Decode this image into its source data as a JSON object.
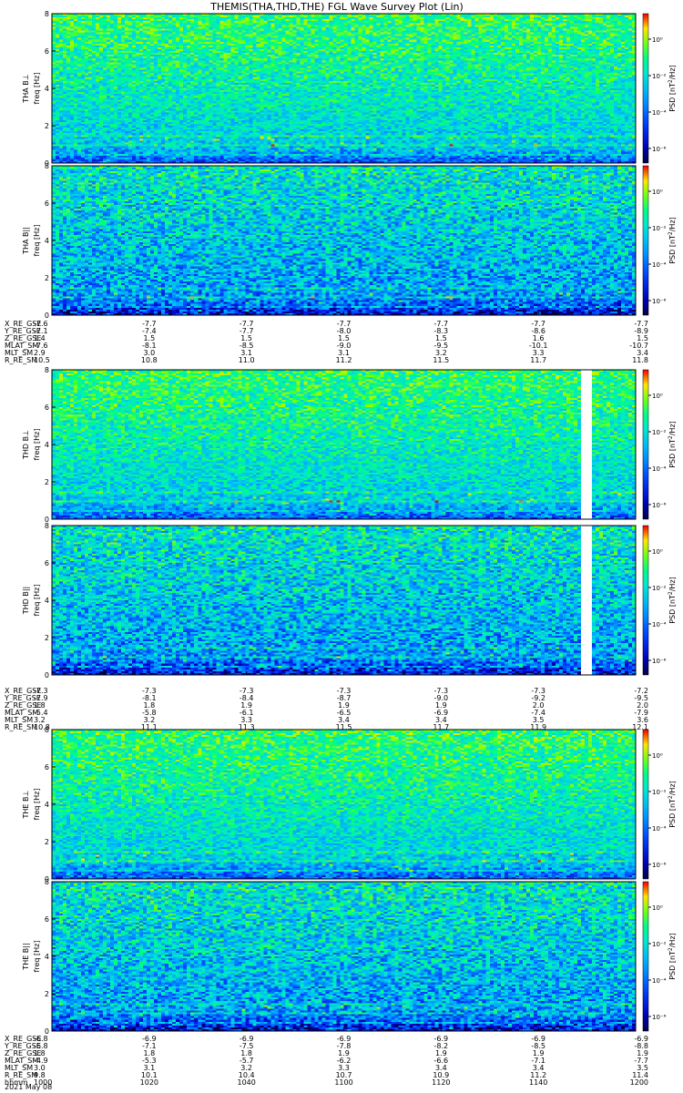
{
  "title": "THEMIS(THA,THD,THE) FGL Wave Survey Plot (Lin)",
  "colorbar_label_prefix": "PSD [nT",
  "colorbar_label_unit": "2",
  "colorbar_label_suffix": "/Hz]",
  "colorbar_ticks": [
    "10⁰",
    "10⁻²",
    "10⁻⁴",
    "10⁻⁶"
  ],
  "colors": {
    "spectrogram_high": "#00ff80",
    "spectrogram_mid": "#00a0ff",
    "spectrogram_low": "#0000c0",
    "spectrogram_min": "#000060",
    "data_gap": "#ffffff"
  },
  "chart_data": {
    "type": "heatmap",
    "x_range_hhmm": [
      "1000",
      "1200"
    ],
    "date": "2021 May 08",
    "ylim": [
      0,
      8
    ],
    "y_ticks": [
      "0",
      "2",
      "4",
      "6",
      "8"
    ],
    "z_scale": "log",
    "z_range": [
      1e-06,
      1.0
    ],
    "panels": [
      {
        "probe": "THA",
        "component": "B⊥",
        "ylabel_probe": "THA B⊥",
        "ylabel_unit": "freq [Hz]",
        "gap": false
      },
      {
        "probe": "THA",
        "component": "B||",
        "ylabel_probe": "THA B||",
        "ylabel_unit": "freq [Hz]",
        "gap": false
      },
      {
        "probe": "THD",
        "component": "B⊥",
        "ylabel_probe": "THD B⊥",
        "ylabel_unit": "freq [Hz]",
        "gap": true,
        "gap_x_fraction": [
          0.912,
          0.925
        ]
      },
      {
        "probe": "THD",
        "component": "B||",
        "ylabel_probe": "THD B||",
        "ylabel_unit": "freq [Hz]",
        "gap": true,
        "gap_x_fraction": [
          0.912,
          0.925
        ]
      },
      {
        "probe": "THE",
        "component": "B⊥",
        "ylabel_probe": "THE B⊥",
        "ylabel_unit": "freq [Hz]",
        "gap": false
      },
      {
        "probe": "THE",
        "component": "B||",
        "ylabel_probe": "THE B||",
        "ylabel_unit": "freq [Hz]",
        "gap": false
      }
    ],
    "ephemeris": [
      {
        "probe": "THA",
        "labels": [
          "X_RE_GSE",
          "Y_RE_GSE",
          "Z_RE_GSE",
          "MLAT_SM",
          "MLT_SM",
          "R_RE_SM"
        ],
        "rows": [
          [
            "-7.6",
            "-7.7",
            "-7.7",
            "-7.7",
            "-7.7",
            "-7.7",
            "-7.7"
          ],
          [
            "-7.1",
            "-7.4",
            "-7.7",
            "-8.0",
            "-8.3",
            "-8.6",
            "-8.9"
          ],
          [
            "1.4",
            "1.5",
            "1.5",
            "1.5",
            "1.5",
            "1.6",
            "1.5"
          ],
          [
            "-7.6",
            "-8.1",
            "-8.5",
            "-9.0",
            "-9.5",
            "-10.1",
            "-10.7"
          ],
          [
            "2.9",
            "3.0",
            "3.1",
            "3.1",
            "3.2",
            "3.3",
            "3.4"
          ],
          [
            "10.5",
            "10.8",
            "11.0",
            "11.2",
            "11.5",
            "11.7",
            "11.8"
          ]
        ]
      },
      {
        "probe": "THD",
        "labels": [
          "X_RE_GSE",
          "Y_RE_GSE",
          "Z_RE_GSE",
          "MLAT_SM",
          "MLT_SM",
          "R_RE_SM"
        ],
        "rows": [
          [
            "-7.3",
            "-7.3",
            "-7.3",
            "-7.3",
            "-7.3",
            "-7.3",
            "-7.2"
          ],
          [
            "-7.9",
            "-8.1",
            "-8.4",
            "-8.7",
            "-9.0",
            "-9.2",
            "-9.5"
          ],
          [
            "1.8",
            "1.8",
            "1.9",
            "1.9",
            "1.9",
            "2.0",
            "2.0"
          ],
          [
            "-5.4",
            "-5.8",
            "-6.1",
            "-6.5",
            "-6.9",
            "-7.4",
            "-7.9"
          ],
          [
            "3.2",
            "3.2",
            "3.3",
            "3.4",
            "3.4",
            "3.5",
            "3.6"
          ],
          [
            "10.8",
            "11.1",
            "11.3",
            "11.5",
            "11.7",
            "11.9",
            "12.1"
          ]
        ]
      },
      {
        "probe": "THE",
        "labels": [
          "X_RE_GSE",
          "Y_RE_GSE",
          "Z_RE_GSE",
          "MLAT_SM",
          "MLT_SM",
          "R_RE_SM",
          "hhmm"
        ],
        "rows": [
          [
            "-6.8",
            "-6.9",
            "-6.9",
            "-6.9",
            "-6.9",
            "-6.9",
            "-6.9"
          ],
          [
            "-6.8",
            "-7.1",
            "-7.5",
            "-7.8",
            "-8.2",
            "-8.5",
            "-8.8"
          ],
          [
            "1.8",
            "1.8",
            "1.8",
            "1.9",
            "1.9",
            "1.9",
            "1.9"
          ],
          [
            "-4.9",
            "-5.3",
            "-5.7",
            "-6.2",
            "-6.6",
            "-7.1",
            "-7.7"
          ],
          [
            "3.0",
            "3.1",
            "3.2",
            "3.3",
            "3.4",
            "3.4",
            "3.5"
          ],
          [
            "9.8",
            "10.1",
            "10.4",
            "10.7",
            "10.9",
            "11.2",
            "11.4"
          ],
          [
            "1000",
            "1020",
            "1040",
            "1100",
            "1120",
            "1140",
            "1200"
          ]
        ]
      }
    ]
  }
}
